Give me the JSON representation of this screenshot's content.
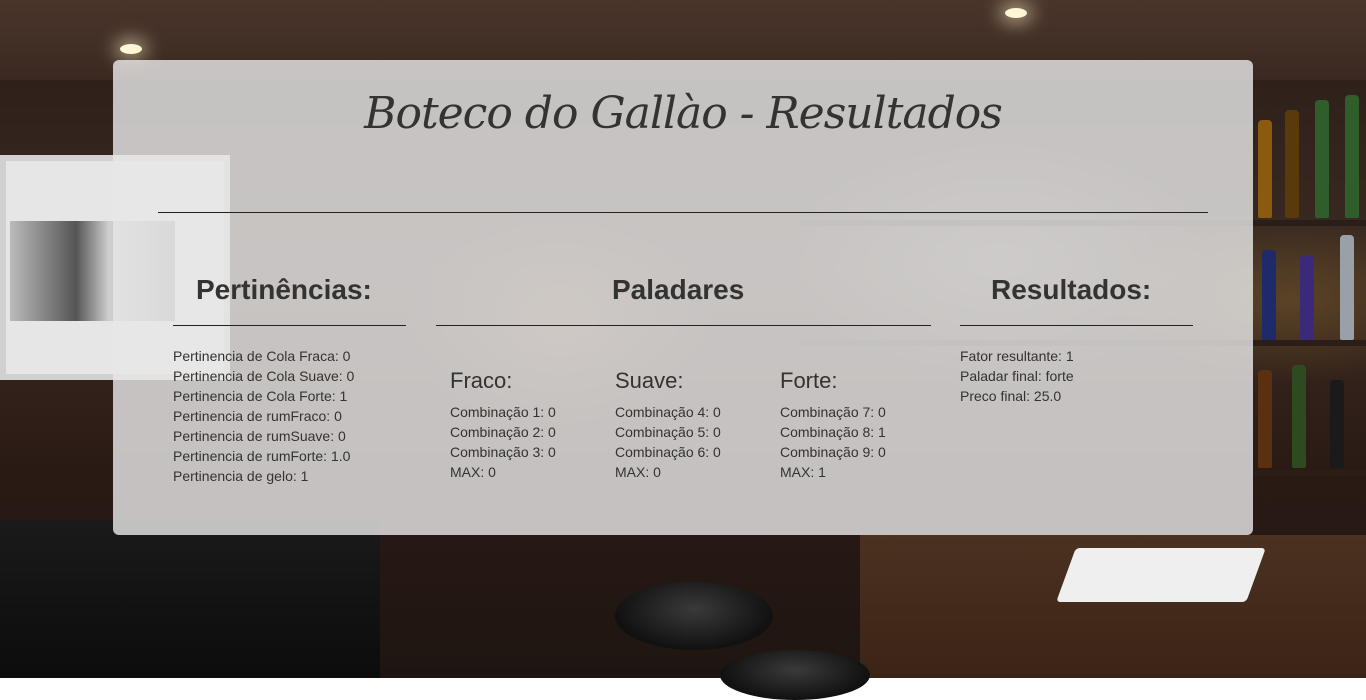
{
  "page": {
    "title": "Boteco do Gallào - Resultados"
  },
  "pertinencias": {
    "heading": "Pertinências:",
    "items": [
      "Pertinencia de Cola Fraca: 0",
      "Pertinencia de Cola Suave: 0",
      "Pertinencia de Cola Forte: 1",
      "Pertinencia de rumFraco: 0",
      "Pertinencia de rumSuave: 0",
      "Pertinencia de rumForte: 1.0",
      "Pertinencia de gelo: 1"
    ]
  },
  "paladares": {
    "heading": "Paladares",
    "groups": [
      {
        "name": "Fraco:",
        "items": [
          "Combinação 1: 0",
          "Combinação 2: 0",
          "Combinação 3: 0",
          "MAX: 0"
        ]
      },
      {
        "name": "Suave:",
        "items": [
          "Combinação 4: 0",
          "Combinação 5: 0",
          "Combinação 6: 0",
          "MAX: 0"
        ]
      },
      {
        "name": "Forte:",
        "items": [
          "Combinação 7: 0",
          "Combinação 8: 1",
          "Combinação 9: 0",
          "MAX: 1"
        ]
      }
    ]
  },
  "resultados": {
    "heading": "Resultados:",
    "items": [
      "Fator resultante: 1",
      "Paladar final: forte",
      "Preco final: 25.0"
    ]
  },
  "colors": {
    "panel": "#e6e6e6",
    "text": "#333333",
    "rule": "#222222"
  }
}
